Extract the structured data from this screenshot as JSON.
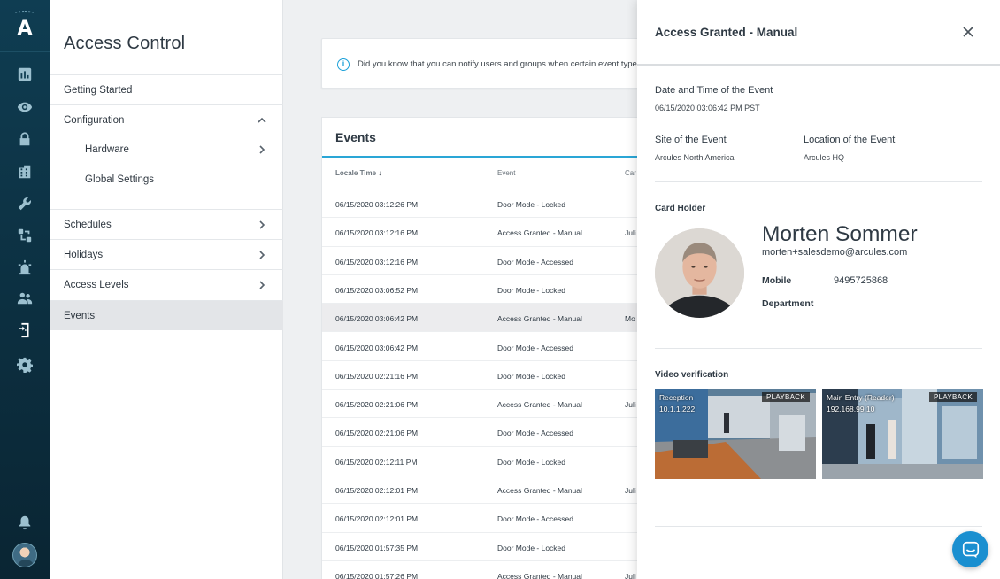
{
  "brand": {
    "logo_letter": "A"
  },
  "rail": {
    "icons": [
      "dashboard-icon",
      "eye-icon",
      "lock-icon",
      "building-icon",
      "wrench-icon",
      "workflow-icon",
      "alarm-icon",
      "users-icon",
      "door-access-icon",
      "gear-icon",
      "bell-icon",
      "user-avatar"
    ]
  },
  "nav": {
    "title": "Access Control",
    "items": [
      {
        "label": "Getting Started"
      },
      {
        "label": "Configuration"
      },
      {
        "label": "Hardware"
      },
      {
        "label": "Global Settings"
      },
      {
        "label": "Schedules"
      },
      {
        "label": "Holidays"
      },
      {
        "label": "Access Levels"
      },
      {
        "label": "Events"
      }
    ]
  },
  "tip": {
    "text": "Did you know that you can notify users and groups when certain event type"
  },
  "events": {
    "title": "Events",
    "columns": {
      "time": "Locale Time",
      "event": "Event",
      "card": "Car"
    },
    "rows": [
      {
        "time": "06/15/2020 03:12:26 PM",
        "event": "Door Mode - Locked",
        "card": ""
      },
      {
        "time": "06/15/2020 03:12:16 PM",
        "event": "Access Granted - Manual",
        "card": "Juli"
      },
      {
        "time": "06/15/2020 03:12:16 PM",
        "event": "Door Mode - Accessed",
        "card": ""
      },
      {
        "time": "06/15/2020 03:06:52 PM",
        "event": "Door Mode - Locked",
        "card": ""
      },
      {
        "time": "06/15/2020 03:06:42 PM",
        "event": "Access Granted - Manual",
        "card": "Mo"
      },
      {
        "time": "06/15/2020 03:06:42 PM",
        "event": "Door Mode - Accessed",
        "card": ""
      },
      {
        "time": "06/15/2020 02:21:16 PM",
        "event": "Door Mode - Locked",
        "card": ""
      },
      {
        "time": "06/15/2020 02:21:06 PM",
        "event": "Access Granted - Manual",
        "card": "Juli"
      },
      {
        "time": "06/15/2020 02:21:06 PM",
        "event": "Door Mode - Accessed",
        "card": ""
      },
      {
        "time": "06/15/2020 02:12:11 PM",
        "event": "Door Mode - Locked",
        "card": ""
      },
      {
        "time": "06/15/2020 02:12:01 PM",
        "event": "Access Granted - Manual",
        "card": "Juli"
      },
      {
        "time": "06/15/2020 02:12:01 PM",
        "event": "Door Mode - Accessed",
        "card": ""
      },
      {
        "time": "06/15/2020 01:57:35 PM",
        "event": "Door Mode - Locked",
        "card": ""
      },
      {
        "time": "06/15/2020 01:57:26 PM",
        "event": "Access Granted - Manual",
        "card": "Juli"
      }
    ]
  },
  "detail": {
    "title": "Access Granted - Manual",
    "datetime_label": "Date and Time of the Event",
    "datetime_value": "06/15/2020 03:06:42 PM PST",
    "site_label": "Site of the Event",
    "site_value": "Arcules North America",
    "location_label": "Location of the Event",
    "location_value": "Arcules HQ",
    "cardholder_label": "Card Holder",
    "cardholder_name": "Morten Sommer",
    "cardholder_email": "morten+salesdemo@arcules.com",
    "mobile_label": "Mobile",
    "mobile_value": "9495725868",
    "department_label": "Department",
    "video_label": "Video verification",
    "cameras": [
      {
        "name": "Reception",
        "ip": "10.1.1.222",
        "badge": "PLAYBACK"
      },
      {
        "name": "Main Entry (Reader)",
        "ip": "192.168.99.10",
        "badge": "PLAYBACK"
      }
    ]
  },
  "colors": {
    "accent": "#2aa6d6",
    "rail": "#0f3d52",
    "chat": "#1a8fd0"
  }
}
